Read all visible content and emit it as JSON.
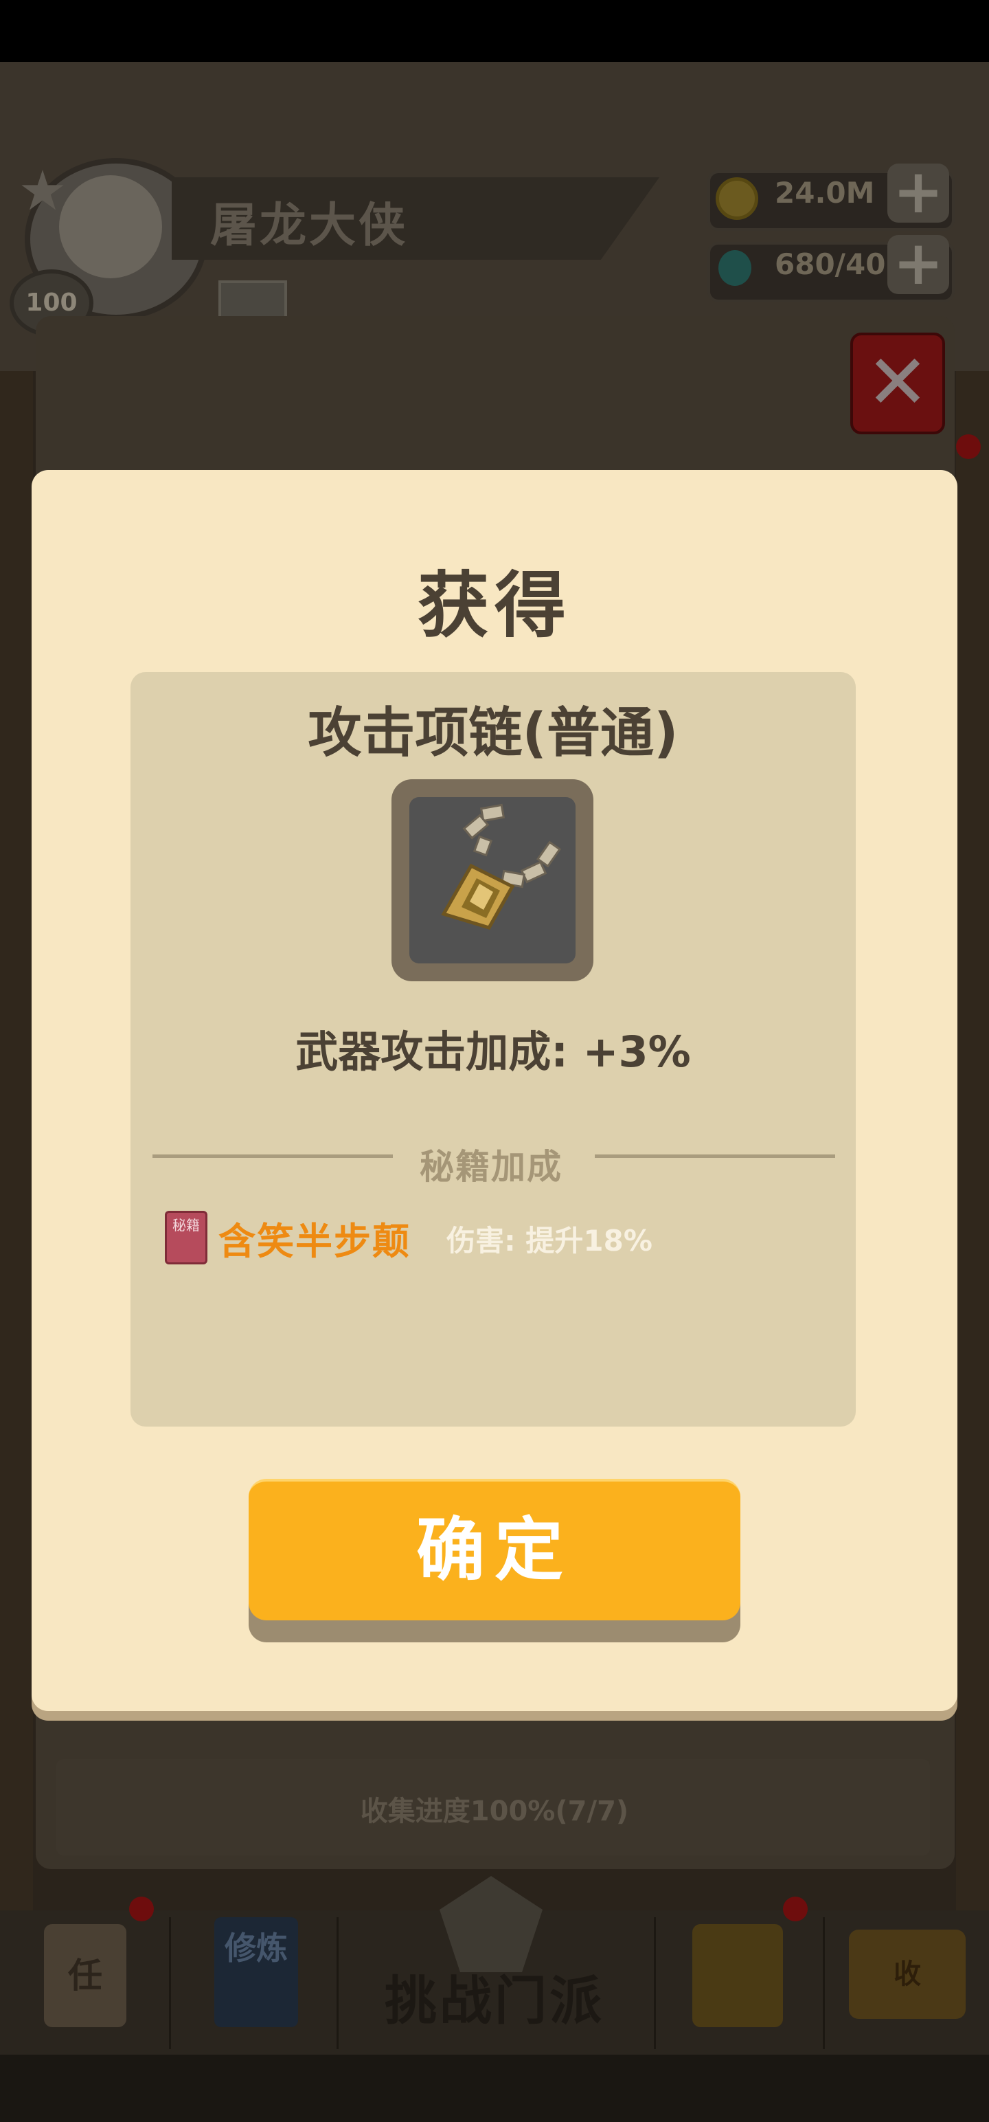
{
  "header": {
    "player_name": "屠龙大侠",
    "level": "100",
    "gold": "24.0M",
    "gems": "680/40",
    "plus_symbol": "+"
  },
  "background": {
    "collection_progress": "收集进度100%(7/7)"
  },
  "bottom_nav": {
    "task_label": "任",
    "cultivate_label": "修炼",
    "challenge_label": "挑战门派",
    "treasure_label": "收"
  },
  "modal": {
    "title": "获得",
    "item_name": "攻击项链(普通)",
    "item_stat": "武器攻击加成: +3%",
    "section_label": "秘籍加成",
    "book_icon_text": "秘籍",
    "skill_name": "含笑半步颠",
    "skill_effect": "伤害: 提升18%",
    "confirm_label": "确定"
  },
  "colors": {
    "modal_bg": "#f8e7c2",
    "panel_bg": "#ddd0ad",
    "confirm_button": "#fbb11d",
    "skill_name": "#ee8a12"
  },
  "icons": {
    "item": "necklace-icon",
    "close": "close-icon",
    "gold": "gold-coin-icon",
    "gem": "gem-icon"
  }
}
